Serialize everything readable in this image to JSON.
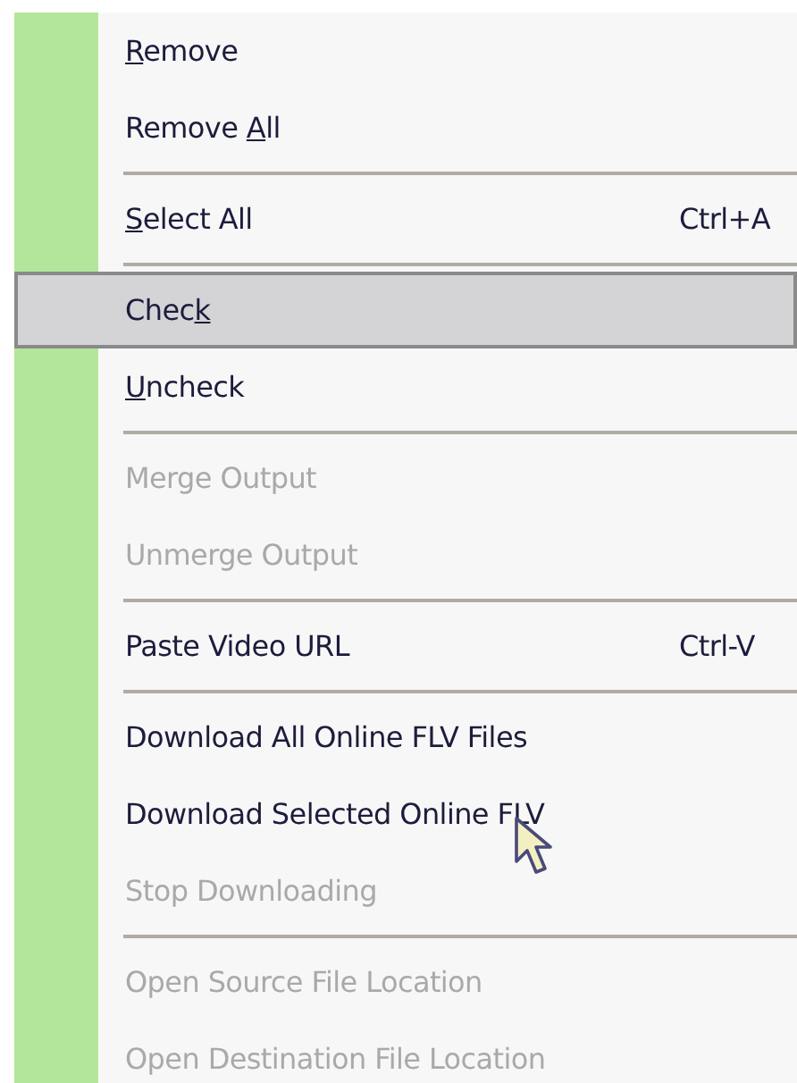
{
  "menu": {
    "entries": [
      {
        "kind": "item",
        "label": {
          "key": "R",
          "post": "emove"
        },
        "disabled": false,
        "selected": false
      },
      {
        "kind": "item",
        "label": {
          "pre": "Remove ",
          "key": "A",
          "post": "ll"
        },
        "disabled": false,
        "selected": false
      },
      {
        "kind": "separator"
      },
      {
        "kind": "item",
        "label": {
          "key": "S",
          "post": "elect All"
        },
        "shortcut": "Ctrl+A",
        "disabled": false,
        "selected": false
      },
      {
        "kind": "separator"
      },
      {
        "kind": "item",
        "label": {
          "pre": "Chec",
          "key": "k"
        },
        "disabled": false,
        "selected": true
      },
      {
        "kind": "item",
        "label": {
          "key": "U",
          "post": "ncheck"
        },
        "disabled": false,
        "selected": false
      },
      {
        "kind": "separator"
      },
      {
        "kind": "item",
        "label": {
          "pre": "Merge Output"
        },
        "disabled": true,
        "selected": false
      },
      {
        "kind": "item",
        "label": {
          "pre": "Unmerge Output"
        },
        "disabled": true,
        "selected": false
      },
      {
        "kind": "separator"
      },
      {
        "kind": "item",
        "label": {
          "pre": "Paste Video URL"
        },
        "shortcut": "Ctrl-V",
        "disabled": false,
        "selected": false
      },
      {
        "kind": "separator"
      },
      {
        "kind": "item",
        "label": {
          "pre": "Download All Online FLV Files"
        },
        "disabled": false,
        "selected": false
      },
      {
        "kind": "item",
        "label": {
          "pre": "Download Selected Online FLV"
        },
        "disabled": false,
        "selected": false,
        "pointer": true
      },
      {
        "kind": "item",
        "label": {
          "pre": "Stop Downloading"
        },
        "disabled": true,
        "selected": false
      },
      {
        "kind": "separator"
      },
      {
        "kind": "item",
        "label": {
          "pre": "Open Source File Location"
        },
        "disabled": true,
        "selected": false
      },
      {
        "kind": "item",
        "label": {
          "pre": "Open Destination File Location"
        },
        "disabled": true,
        "selected": false
      }
    ]
  }
}
